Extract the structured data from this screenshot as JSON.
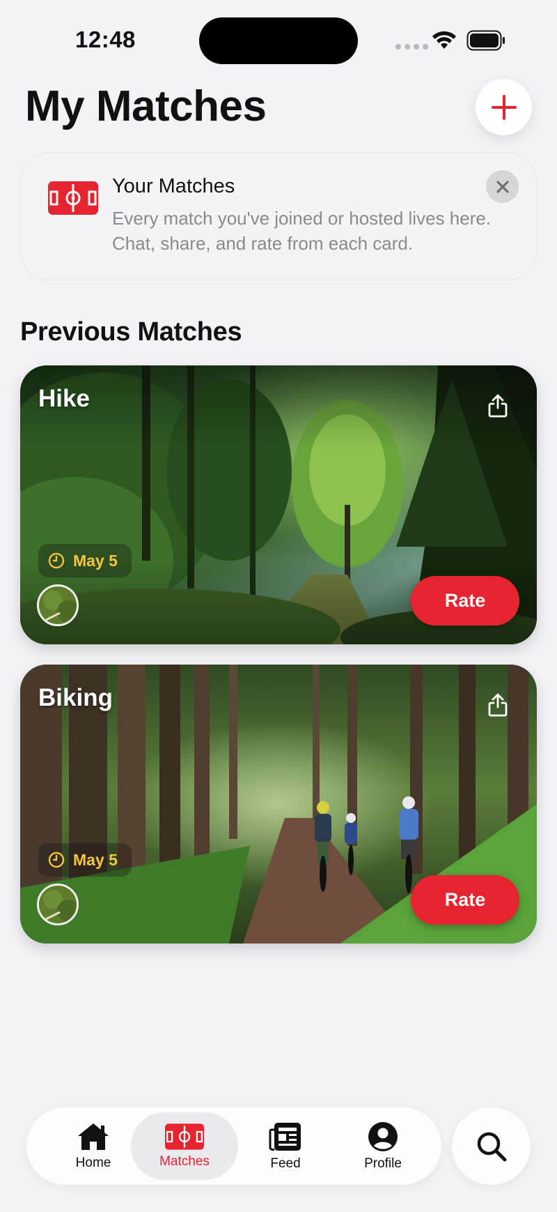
{
  "status_bar": {
    "time": "12:48"
  },
  "header": {
    "title": "My Matches"
  },
  "info_card": {
    "title": "Your Matches",
    "description": "Every match you've joined or hosted lives here. Chat, share, and rate from each card."
  },
  "section": {
    "title": "Previous Matches"
  },
  "matches": [
    {
      "title": "Hike",
      "date": "May 5",
      "action_label": "Rate"
    },
    {
      "title": "Biking",
      "date": "May 5",
      "action_label": "Rate"
    }
  ],
  "tab_bar": {
    "items": [
      {
        "label": "Home",
        "icon": "house-icon"
      },
      {
        "label": "Matches",
        "icon": "field-icon",
        "selected": true
      },
      {
        "label": "Feed",
        "icon": "newspaper-icon"
      },
      {
        "label": "Profile",
        "icon": "person-icon"
      }
    ],
    "search_icon": "search-icon"
  },
  "colors": {
    "accent": "#e5242f",
    "date_text": "#f4c542",
    "background": "#f2f2f7"
  }
}
